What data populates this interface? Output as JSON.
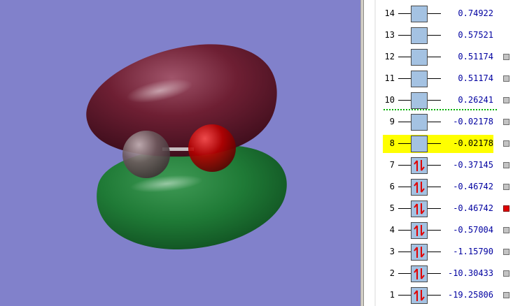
{
  "viewport": {
    "background": "#8181cb",
    "orbital_positive_color": "#6e1f33",
    "orbital_negative_color": "#1f7a36",
    "atom_left_color": "#6e5a5e",
    "atom_right_color": "#b50000"
  },
  "orbitals": [
    {
      "index": "14",
      "energy": "0.74922",
      "electrons": 0,
      "checkbox": "none",
      "selected": false
    },
    {
      "index": "13",
      "energy": "0.57521",
      "electrons": 0,
      "checkbox": "none",
      "selected": false
    },
    {
      "index": "12",
      "energy": "0.51174",
      "electrons": 0,
      "checkbox": "off",
      "selected": false
    },
    {
      "index": "11",
      "energy": "0.51174",
      "electrons": 0,
      "checkbox": "off",
      "selected": false
    },
    {
      "index": "10",
      "energy": "0.26241",
      "electrons": 0,
      "checkbox": "off",
      "selected": false
    },
    {
      "index": "9",
      "energy": "-0.02178",
      "electrons": 0,
      "checkbox": "off",
      "selected": false
    },
    {
      "index": "8",
      "energy": "-0.02178",
      "electrons": 0,
      "checkbox": "off",
      "selected": true
    },
    {
      "index": "7",
      "energy": "-0.37145",
      "electrons": 2,
      "checkbox": "off",
      "selected": false
    },
    {
      "index": "6",
      "energy": "-0.46742",
      "electrons": 2,
      "checkbox": "off",
      "selected": false
    },
    {
      "index": "5",
      "energy": "-0.46742",
      "electrons": 2,
      "checkbox": "on",
      "selected": false
    },
    {
      "index": "4",
      "energy": "-0.57004",
      "electrons": 2,
      "checkbox": "off",
      "selected": false
    },
    {
      "index": "3",
      "energy": "-1.15790",
      "electrons": 2,
      "checkbox": "off",
      "selected": false
    },
    {
      "index": "2",
      "energy": "-10.30433",
      "electrons": 2,
      "checkbox": "off",
      "selected": false
    },
    {
      "index": "1",
      "energy": "-19.25806",
      "electrons": 2,
      "checkbox": "off",
      "selected": false
    }
  ],
  "colors": {
    "box_fill": "#a4c2e2",
    "electron_arrow": "#e00000",
    "highlight": "#ffff00",
    "energy_text": "#0000a0",
    "checkbox_on": "#e00000",
    "checkbox_off": "#c4c4c4",
    "homo_lumo_divider": "#00b000"
  }
}
